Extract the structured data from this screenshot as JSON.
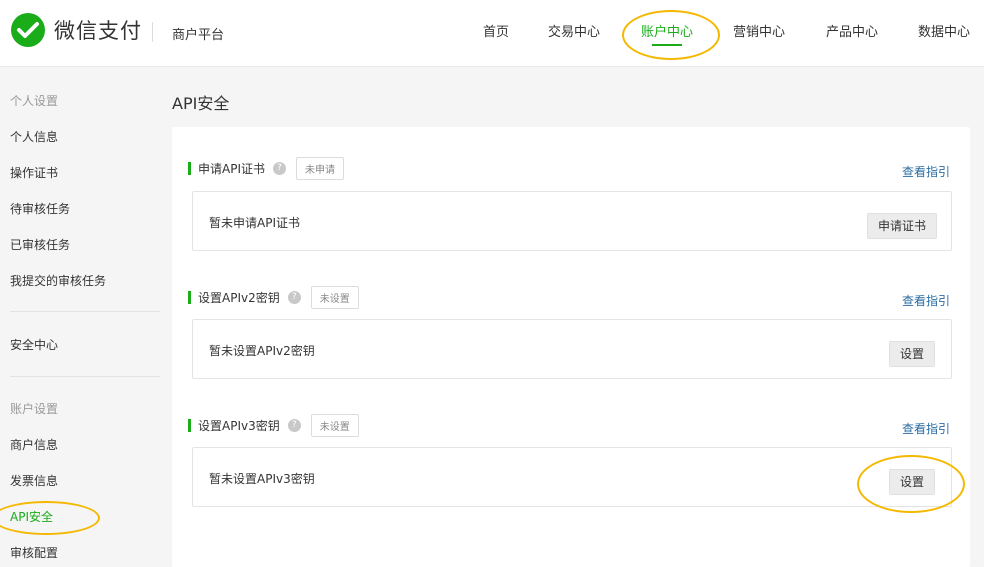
{
  "header": {
    "logo_text": "微信支付",
    "platform": "商户平台",
    "nav": [
      {
        "label": "首页"
      },
      {
        "label": "交易中心"
      },
      {
        "label": "账户中心",
        "active": true
      },
      {
        "label": "营销中心"
      },
      {
        "label": "产品中心"
      },
      {
        "label": "数据中心"
      }
    ]
  },
  "sidebar": {
    "group1_heading": "个人设置",
    "group1_items": [
      "个人信息",
      "操作证书",
      "待审核任务",
      "已审核任务",
      "我提交的审核任务"
    ],
    "security_center": "安全中心",
    "group2_heading": "账户设置",
    "group2_items": [
      "商户信息",
      "发票信息",
      "API安全",
      "审核配置"
    ],
    "active_item": "API安全"
  },
  "main": {
    "title": "API安全",
    "sections": [
      {
        "title": "申请API证书",
        "status": "未申请",
        "guide_link": "查看指引",
        "card_text": "暂未申请API证书",
        "button": "申请证书"
      },
      {
        "title": "设置APIv2密钥",
        "status": "未设置",
        "guide_link": "查看指引",
        "card_text": "暂未设置APIv2密钥",
        "button": "设置"
      },
      {
        "title": "设置APIv3密钥",
        "status": "未设置",
        "guide_link": "查看指引",
        "card_text": "暂未设置APIv3密钥",
        "button": "设置"
      }
    ]
  },
  "colors": {
    "brand_green": "#1aad19",
    "link_blue": "#2b6ca3",
    "highlight_circle": "#f5b800"
  },
  "icons": {
    "logo": "wechat-pay-check-icon",
    "help": "question-circle-icon"
  }
}
